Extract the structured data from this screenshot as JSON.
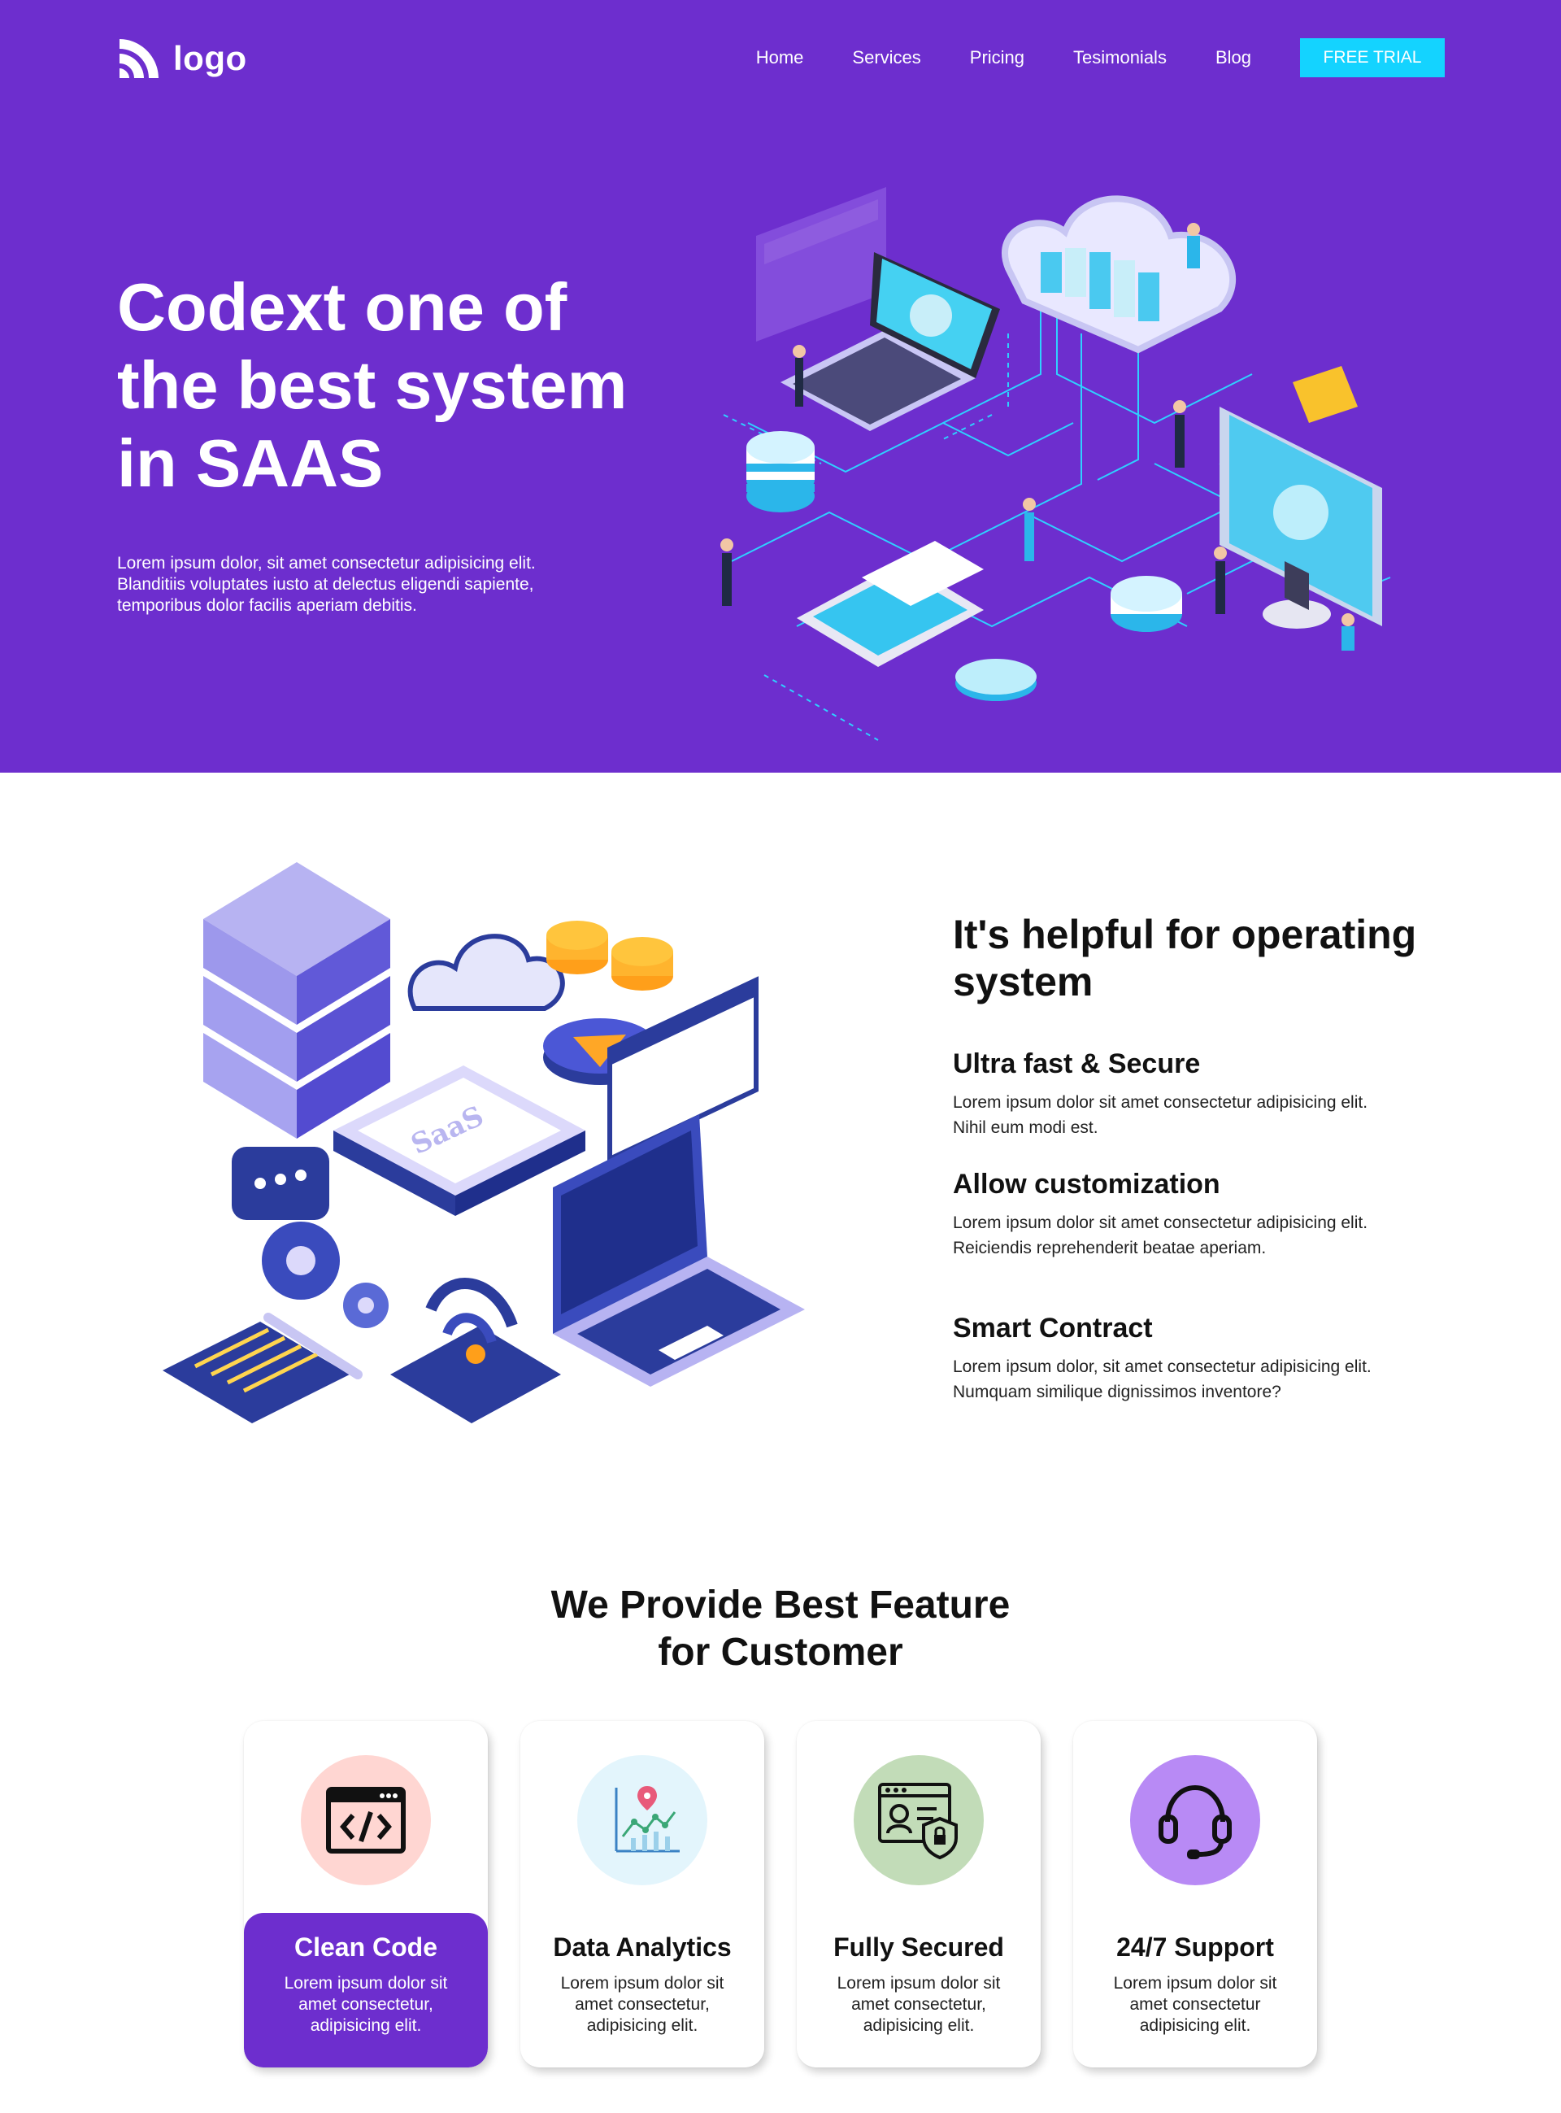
{
  "nav": {
    "logo_text": "logo",
    "links": [
      "Home",
      "Services",
      "Pricing",
      "Tesimonials",
      "Blog"
    ],
    "cta": "FREE TRIAL"
  },
  "hero": {
    "title": "Codext one of the best system in SAAS",
    "text": "Lorem ipsum dolor, sit amet consectetur adipisicing elit. Blanditiis voluptates iusto at delectus eligendi sapiente, temporibus dolor facilis aperiam debitis."
  },
  "features_intro": {
    "title": "It's helpful for operating system",
    "illustration_label": "SaaS",
    "items": [
      {
        "title": "Ultra fast & Secure",
        "text": "Lorem ipsum dolor sit amet consectetur adipisicing elit. Nihil eum modi est."
      },
      {
        "title": "Allow customization",
        "text": "Lorem ipsum dolor sit amet consectetur adipisicing elit. Reiciendis reprehenderit beatae aperiam."
      },
      {
        "title": "Smart Contract",
        "text": "Lorem ipsum dolor, sit amet consectetur adipisicing elit. Numquam similique dignissimos inventore?"
      }
    ]
  },
  "best_features": {
    "title_line1": "We Provide Best Feature",
    "title_line2": "for Customer",
    "cards": [
      {
        "title": "Clean Code",
        "text": "Lorem ipsum dolor sit amet consectetur, adipisicing elit.",
        "icon": "code-window-icon",
        "circle_color": "#ffd6d2",
        "active": true
      },
      {
        "title": "Data Analytics",
        "text": "Lorem ipsum dolor sit amet consectetur, adipisicing elit.",
        "icon": "analytics-chart-icon",
        "circle_color": "#e3f5fc",
        "active": false
      },
      {
        "title": "Fully Secured",
        "text": "Lorem ipsum dolor sit amet consectetur, adipisicing elit.",
        "icon": "secure-profile-icon",
        "circle_color": "#c2dcb8",
        "active": false
      },
      {
        "title": "24/7 Support",
        "text": "Lorem ipsum dolor sit amet consectetur adipisicing elit.",
        "icon": "headset-icon",
        "circle_color": "#b88af5",
        "active": false
      }
    ]
  },
  "colors": {
    "brand_purple": "#6d2ece",
    "cta_cyan": "#14d3ff"
  }
}
